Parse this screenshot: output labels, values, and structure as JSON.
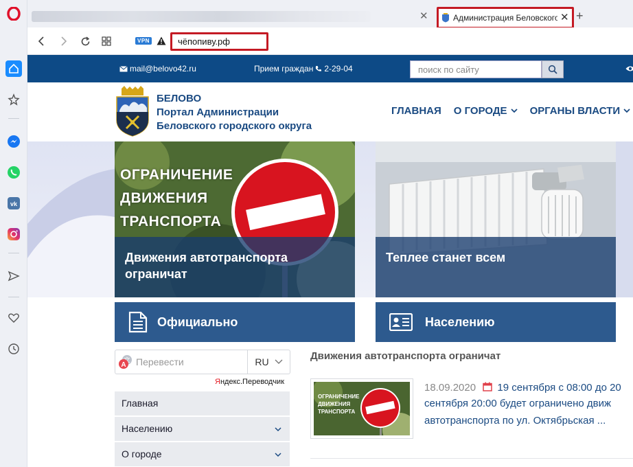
{
  "browser": {
    "tab_title": "Администрация Беловского",
    "url": "чёпопиву.рф",
    "vpn_label": "VPN"
  },
  "sidebar": {
    "icons": [
      "opera-logo-icon",
      "home-icon",
      "star-icon",
      "messenger-icon",
      "whatsapp-icon",
      "vk-icon",
      "instagram-icon",
      "send-icon",
      "heart-icon",
      "clock-icon"
    ]
  },
  "site": {
    "topbar": {
      "email": "mail@belovo42.ru",
      "reception_label": "Прием граждан",
      "reception_phone": "2-29-04",
      "search_placeholder": "поиск по сайту"
    },
    "header": {
      "title_line1": "БЕЛОВО",
      "title_line2": "Портал Администрации",
      "title_line3": "Беловского городского округа"
    },
    "nav": {
      "home": "ГЛАВНАЯ",
      "about": "О ГОРОДЕ",
      "authorities": "ОРГАНЫ ВЛАСТИ"
    },
    "hero": {
      "banner_line1": "ОГРАНИЧЕНИЕ",
      "banner_line2": "ДВИЖЕНИЯ",
      "banner_line3": "ТРАНСПОРТА",
      "card1_caption": "Движения автотранспорта ограничат",
      "card2_caption": "Теплее станет всем"
    },
    "categories": {
      "official": "Официально",
      "population": "Населению"
    },
    "translator": {
      "placeholder": "Перевести",
      "lang": "RU",
      "credit_y": "Я",
      "credit_rest": "ндекс.Переводчик"
    },
    "side_menu": {
      "home": "Главная",
      "population": "Населению",
      "about": "О городе"
    },
    "news": {
      "heading": "Движения автотранспорта ограничат",
      "thumb_line1": "ОГРАНИЧЕНИЕ",
      "thumb_line2": "ДВИЖЕНИЯ",
      "thumb_line3": "ТРАНСПОРТА",
      "date": "18.09.2020",
      "event_start": "19 сентября с 08:00 до 20",
      "line2": "сентября 20:00 будет ограничено движ",
      "line3": "автотранспорта по ул. Октябрьская ..."
    }
  },
  "colors": {
    "site_blue": "#0d4a86",
    "accent_red": "#c41a24",
    "card_blue": "#2d5a8e"
  }
}
